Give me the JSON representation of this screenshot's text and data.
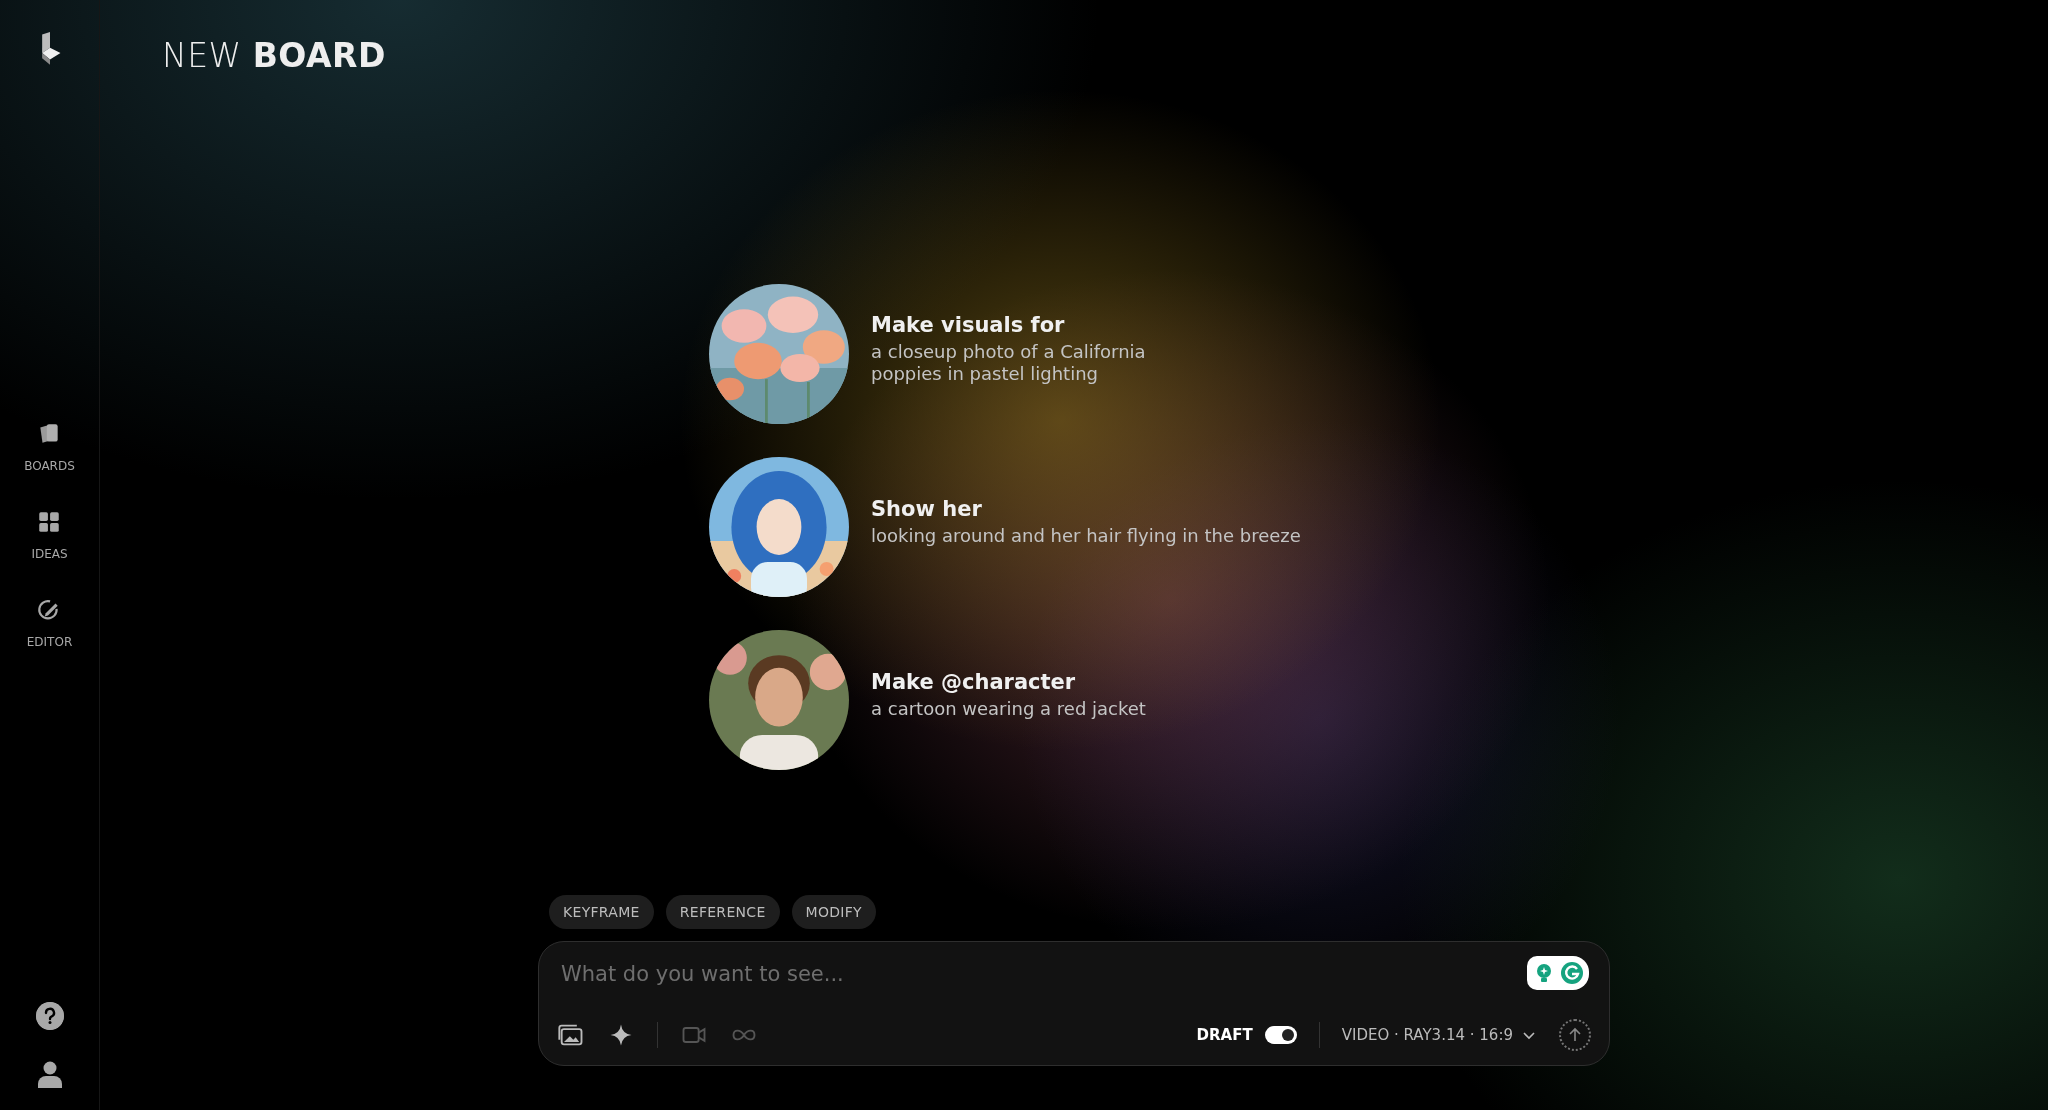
{
  "sidebar": {
    "nav": [
      {
        "kind": "boards",
        "label": "BOARDS",
        "selected": false
      },
      {
        "kind": "ideas",
        "label": "IDEAS",
        "selected": false
      },
      {
        "kind": "editor",
        "label": "EDITOR",
        "selected": false
      }
    ]
  },
  "header": {
    "title_light": "NEW",
    "title_bold": "BOARD"
  },
  "suggestions": [
    {
      "kind": "flowers",
      "heading": "Make visuals for",
      "text": "a closeup photo of a California poppies in pastel lighting"
    },
    {
      "kind": "anime",
      "heading": "Show her",
      "text": "looking around and her hair flying in the breeze"
    },
    {
      "kind": "man",
      "heading": "Make @character",
      "text": "a cartoon wearing a red jacket"
    }
  ],
  "modes": [
    {
      "label": "KEYFRAME"
    },
    {
      "label": "REFERENCE"
    },
    {
      "label": "MODIFY"
    }
  ],
  "composer": {
    "placeholder": "What do you want to see...",
    "tools": [
      {
        "kind": "images",
        "disabled": false
      },
      {
        "kind": "sparkle",
        "disabled": false
      },
      {
        "kind": "video",
        "disabled": true
      },
      {
        "kind": "loop",
        "disabled": true
      }
    ],
    "draft": {
      "label": "DRAFT",
      "on": true
    },
    "model": "VIDEO · RAY3.14 · 16:9",
    "send_disabled": true
  }
}
